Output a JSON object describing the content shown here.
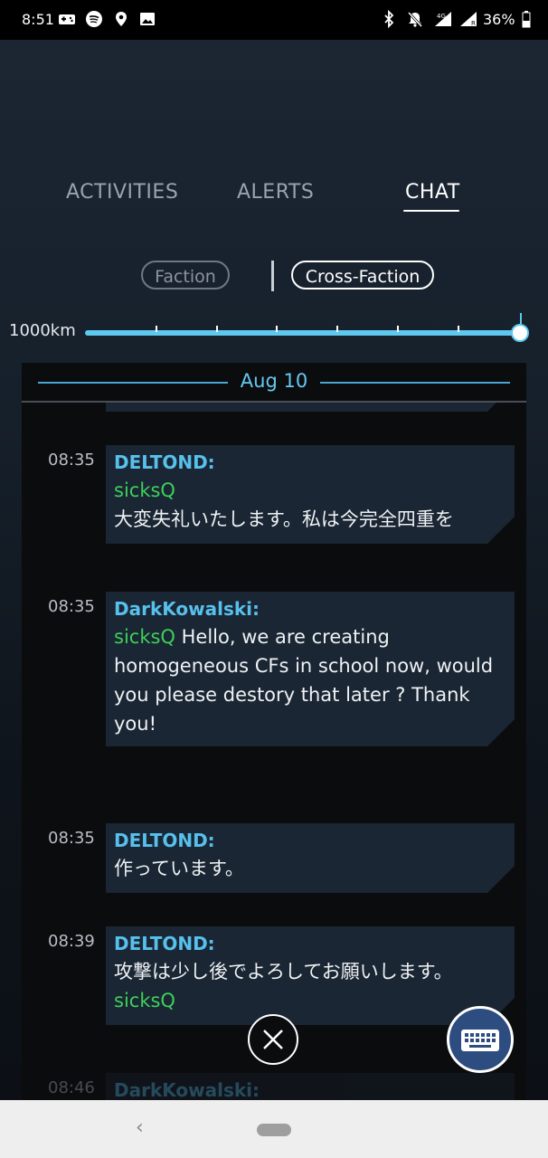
{
  "status_bar": {
    "time": "8:51",
    "battery": "36%",
    "icons": [
      "gamepad-icon",
      "spotify-icon",
      "location-icon",
      "image-icon",
      "bluetooth-icon",
      "mute-icon",
      "signal-4g-icon",
      "signal-r-icon",
      "battery-icon"
    ]
  },
  "tabs": [
    {
      "label": "ACTIVITIES",
      "active": false
    },
    {
      "label": "ALERTS",
      "active": false
    },
    {
      "label": "CHAT",
      "active": true
    }
  ],
  "filters": {
    "faction": "Faction",
    "cross_faction": "Cross-Faction",
    "selected": "Cross-Faction"
  },
  "range": {
    "label": "1000km",
    "value_fraction": 1.0
  },
  "date_header": "Aug 10",
  "messages": [
    {
      "time": "08:35",
      "sender": "DELTOND:",
      "mention": "sicksQ",
      "text_lines": [
        "大変失礼いたします。私は今完全四重を"
      ]
    },
    {
      "time": "08:35",
      "sender": "DarkKowalski:",
      "mention": "sicksQ",
      "first_line_rest": " Hello, we are creating",
      "text_lines": [
        "homogeneous CFs in school now, would",
        "you please destory that later ? Thank",
        "you!"
      ]
    },
    {
      "time": "08:35",
      "sender": "DELTOND:",
      "text_lines": [
        "作っています。"
      ]
    },
    {
      "time": "08:39",
      "sender": "DELTOND:",
      "text_lines": [
        "攻撃は少し後でよろしてお願いします。"
      ],
      "mention": "sicksQ"
    },
    {
      "time": "08:46",
      "sender": "DarkKowalski:"
    }
  ],
  "colors": {
    "accent": "#57c0ec",
    "mention": "#3ecf5b",
    "bubble": "#1a2633",
    "keyboard_button": "#2d4c80"
  },
  "buttons": {
    "close_icon": "close-icon",
    "keyboard_icon": "keyboard-icon"
  }
}
